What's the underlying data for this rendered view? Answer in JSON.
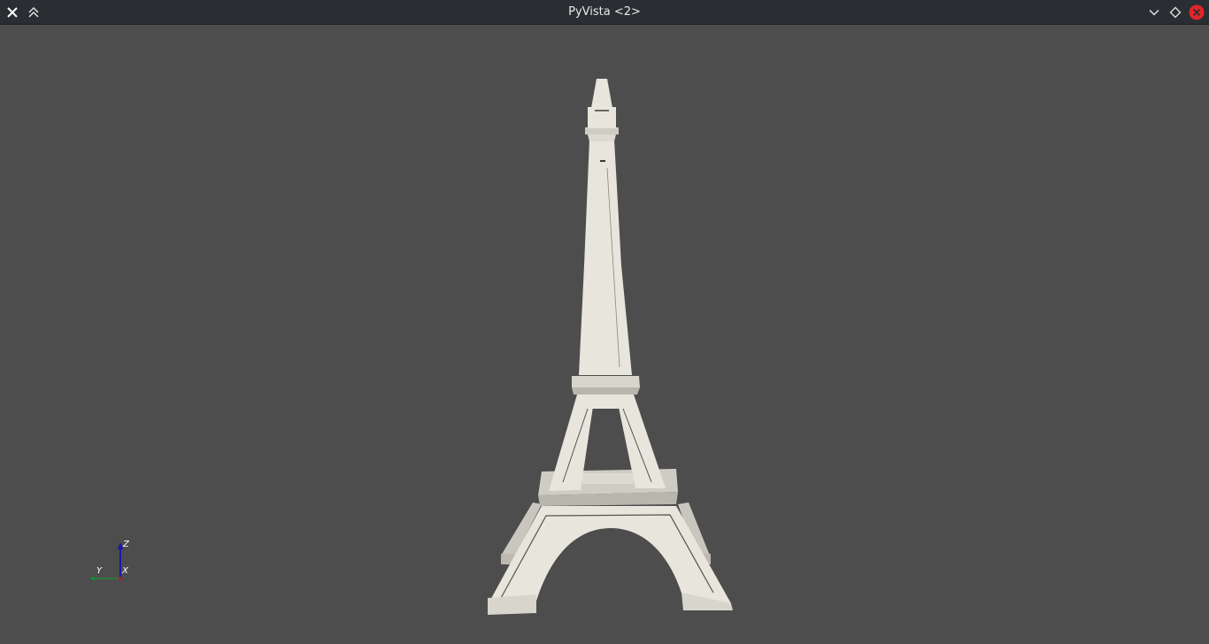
{
  "window": {
    "title": "PyVista <2>",
    "icons": {
      "left": [
        "close-x-icon",
        "keep-above-icon"
      ],
      "right": [
        "minimize-icon",
        "maximize-icon",
        "close-icon"
      ]
    },
    "colors": {
      "titlebar": "#2a2e32",
      "background": "#4d4d4d",
      "close_button": "#e0262a",
      "model": "#e8e5dc"
    }
  },
  "axes": {
    "z_label": "Z",
    "y_label": "Y",
    "x_label": "X"
  }
}
